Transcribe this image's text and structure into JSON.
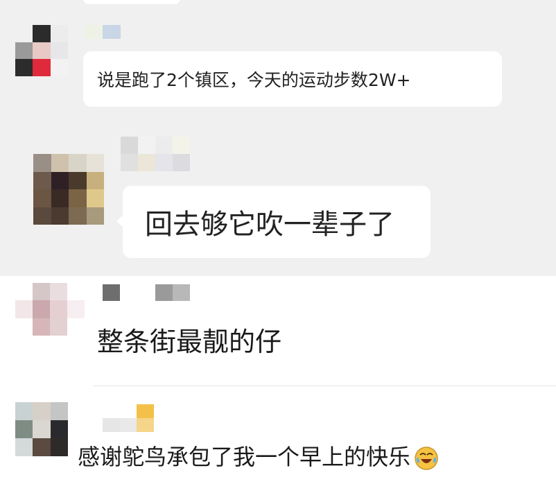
{
  "comments": [
    {
      "text": "说是跑了2个镇区，今天的运动步数2W+"
    },
    {
      "text": "回去够它吹一辈子了"
    },
    {
      "text": "整条街最靓的仔"
    },
    {
      "text": "感谢鸵鸟承包了我一个早上的快乐",
      "emoji": "laughing-crying-emoji"
    }
  ],
  "colors": {
    "chat_background": "#f0f0f0",
    "bubble": "#ffffff",
    "text": "#222222",
    "emoji_face": "#f5c242"
  }
}
